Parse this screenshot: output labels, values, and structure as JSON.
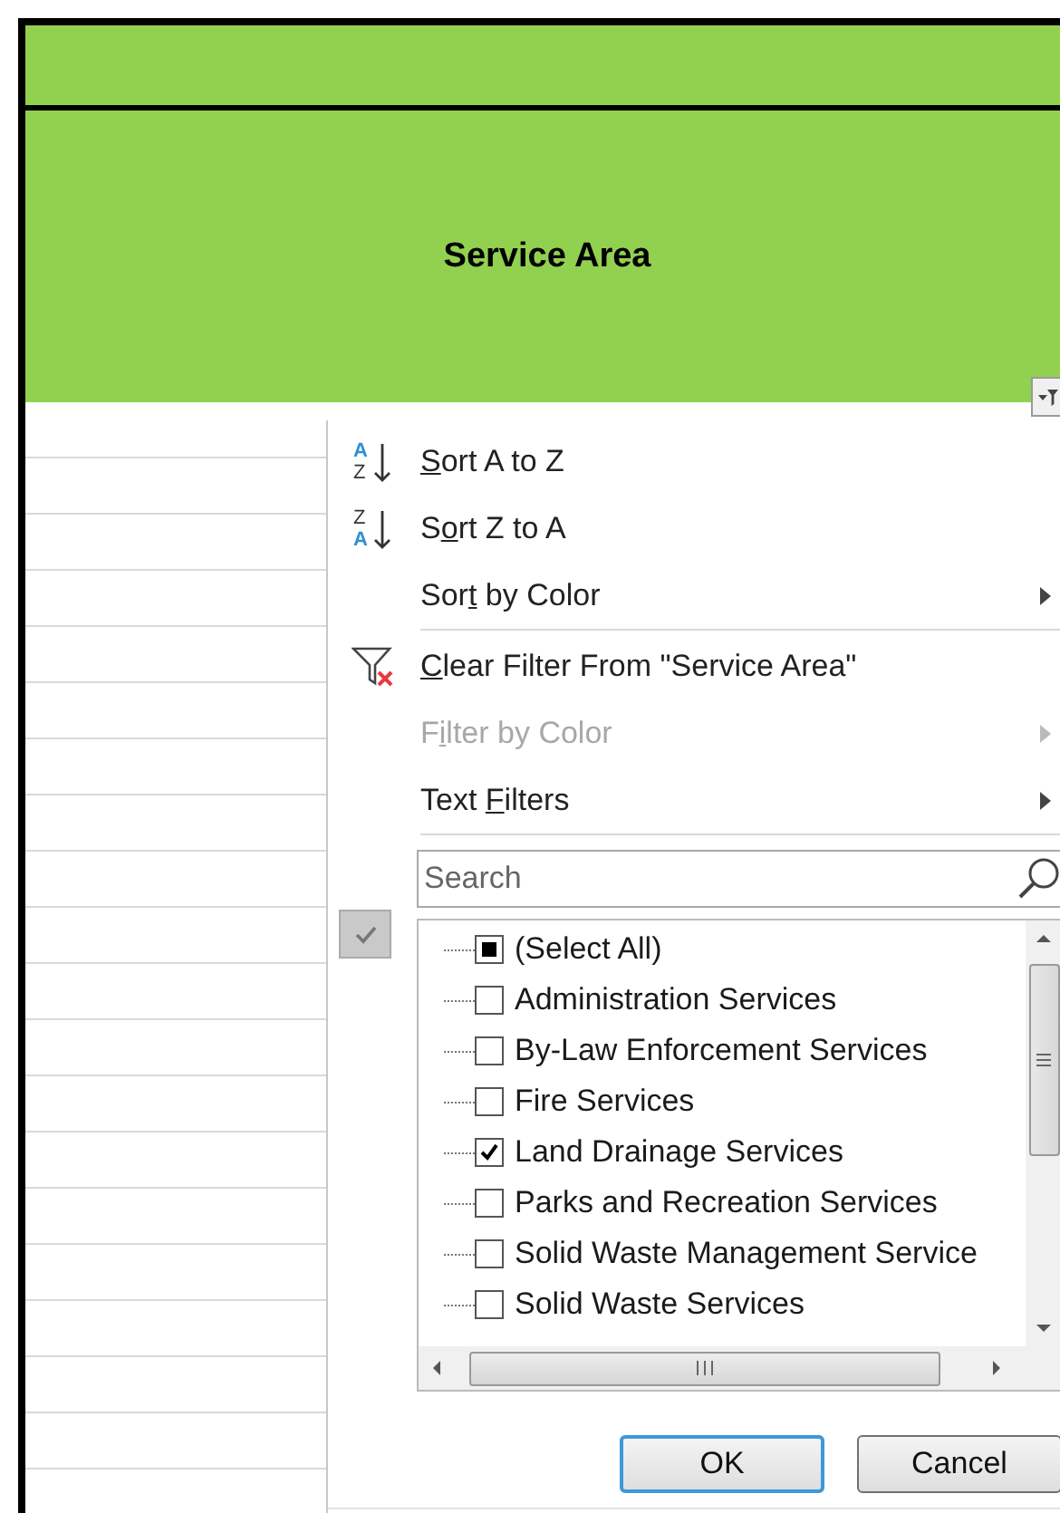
{
  "header": {
    "title": "Service Area"
  },
  "menu_items": [
    {
      "kind": "sort-asc",
      "icon_top": "A",
      "icon_bottom": "Z",
      "key": "S",
      "after": "ort A to Z",
      "disabled": false,
      "submenu": false,
      "separator_after": false
    },
    {
      "kind": "sort-desc",
      "icon_top": "Z",
      "icon_bottom": "A",
      "before": "S",
      "key": "o",
      "after": "rt Z to A",
      "disabled": false,
      "submenu": false,
      "separator_after": false
    },
    {
      "kind": "plain",
      "before": "Sor",
      "key": "t",
      "after": " by Color",
      "disabled": false,
      "submenu": true,
      "separator_after": true
    },
    {
      "kind": "clear-filter",
      "key": "C",
      "after": "lear Filter From \"Service Area\"",
      "disabled": false,
      "submenu": false,
      "separator_after": false
    },
    {
      "kind": "plain",
      "before": "F",
      "key": "i",
      "after": "lter by Color",
      "disabled": true,
      "submenu": true,
      "separator_after": false
    },
    {
      "kind": "plain",
      "before": "Text ",
      "key": "F",
      "after": "ilters",
      "disabled": false,
      "submenu": true,
      "separator_after": true
    }
  ],
  "search": {
    "placeholder": "Search"
  },
  "values": [
    {
      "label": "(Select All)",
      "checked": false,
      "mixed": true
    },
    {
      "label": "Administration Services",
      "checked": false,
      "mixed": false
    },
    {
      "label": "By-Law Enforcement Services",
      "checked": false,
      "mixed": false
    },
    {
      "label": "Fire Services",
      "checked": false,
      "mixed": false
    },
    {
      "label": "Land Drainage Services",
      "checked": true,
      "mixed": false
    },
    {
      "label": "Parks and Recreation Services",
      "checked": false,
      "mixed": false
    },
    {
      "label": "Solid Waste Management Service",
      "checked": false,
      "mixed": false
    },
    {
      "label": "Solid Waste Services",
      "checked": false,
      "mixed": false
    }
  ],
  "buttons": [
    {
      "label": "OK",
      "default": true
    },
    {
      "label": "Cancel",
      "default": false
    }
  ]
}
